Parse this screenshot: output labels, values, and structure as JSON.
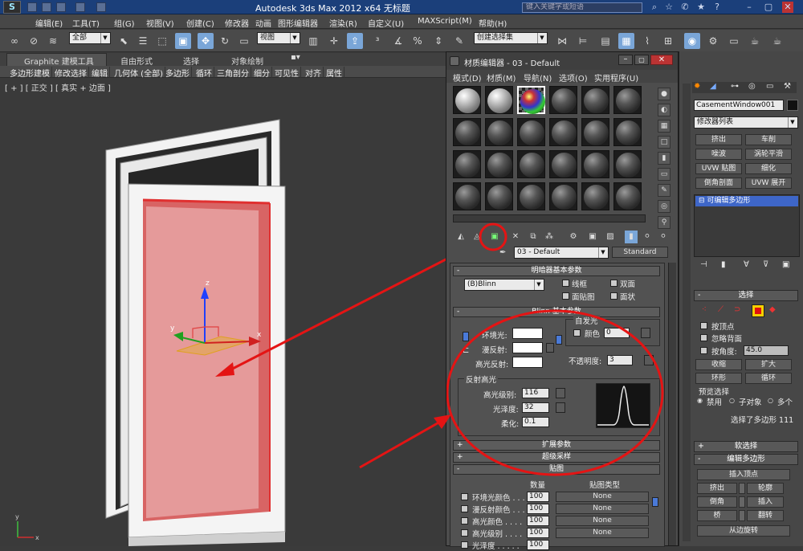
{
  "app": {
    "logo_text": "S",
    "title": "Autodesk 3ds Max  2012 x64     无标题",
    "search_placeholder": "键入关键字或短语"
  },
  "menubar": {
    "items": [
      "编辑(E)",
      "工具(T)",
      "组(G)",
      "视图(V)",
      "创建(C)",
      "修改器",
      "动画",
      "图形编辑器",
      "渲染(R)",
      "自定义(U)",
      "MAXScript(M)",
      "帮助(H)"
    ]
  },
  "toolbar": {
    "selection_filter": "全部",
    "ref_coord": "视图",
    "named_selection": "创建选择集"
  },
  "ribbon": {
    "tabs": [
      "Graphite 建模工具",
      "自由形式",
      "选择",
      "对象绘制"
    ],
    "row_items": [
      "多边形建模",
      "修改选择",
      "编辑",
      "几何体 (全部)",
      "多边形",
      "循环",
      "三角剖分",
      "细分",
      "可见性",
      "对齐",
      "属性"
    ]
  },
  "viewport": {
    "label": "[ + ] [ 正交 ] [ 真实 + 边面 ]",
    "gizmo_x": "x",
    "gizmo_y": "y",
    "gizmo_z": "z",
    "axis_y": "y",
    "axis_x": "x"
  },
  "material_editor": {
    "title": "材质编辑器 - 03 - Default",
    "menu": [
      "模式(D)",
      "材质(M)",
      "导航(N)",
      "选项(O)",
      "实用程序(U)"
    ],
    "material_name": "03 - Default",
    "material_type": "Standard",
    "shader_rollout": "明暗器基本参数",
    "shader": "(B)Blinn",
    "wire": "线框",
    "two_sided": "双面",
    "face_map": "面贴图",
    "faceted": "面状",
    "blinn_rollout": "Blinn 基本参数",
    "self_illum": "自发光",
    "color_label": "颜色",
    "color_value": "0",
    "ambient": "环境光:",
    "diffuse": "漫反射:",
    "specular": "高光反射:",
    "opacity_label": "不透明度:",
    "opacity_value": "3",
    "spec_highlights": "反射高光",
    "spec_level_label": "高光级别:",
    "spec_level": "116",
    "glossiness_label": "光泽度:",
    "glossiness": "32",
    "soften_label": "柔化:",
    "soften": "0.1",
    "extended_rollout": "扩展参数",
    "supersampling_rollout": "超级采样",
    "maps_rollout": "贴图",
    "maps_header_amount": "数量",
    "maps_header_type": "贴图类型",
    "maps": [
      {
        "name": "环境光颜色 . . .",
        "amount": "100",
        "map": "None"
      },
      {
        "name": "漫反射颜色 . . .",
        "amount": "100",
        "map": "None"
      },
      {
        "name": "高光颜色 . . . .",
        "amount": "100",
        "map": "None"
      },
      {
        "name": "高光级别 . . . .",
        "amount": "100",
        "map": "None"
      },
      {
        "name": "光泽度 . . . . .",
        "amount": "100",
        "map": "None"
      }
    ]
  },
  "command_panel": {
    "object_name": "CasementWindow001",
    "modifier_list": "修改器列表",
    "modifier_buttons": [
      "挤出",
      "车削",
      "噪波",
      "涡轮平滑",
      "UVW 贴图",
      "细化",
      "倒角剖面",
      "UVW 展开"
    ],
    "stack_item": "可编辑多边形",
    "selection_rollout": "选择",
    "by_vertex": "按顶点",
    "ignore_backfacing": "忽略背面",
    "by_angle": "按角度:",
    "angle_value": "45.0",
    "shrink": "收缩",
    "grow": "扩大",
    "ring": "环形",
    "loop": "循环",
    "preview_selection": "预览选择",
    "preview_options": [
      "禁用",
      "子对象",
      "多个"
    ],
    "selected_status": "选择了多边形 111",
    "soft_selection": "软选择",
    "edit_polygons": "编辑多边形",
    "insert_vertex": "插入顶点",
    "buttons_row1": [
      "挤出",
      "轮廓"
    ],
    "buttons_row2": [
      "倒角",
      "插入"
    ],
    "buttons_row3": [
      "桥",
      "翻转"
    ],
    "hinge": "从边旋转"
  }
}
